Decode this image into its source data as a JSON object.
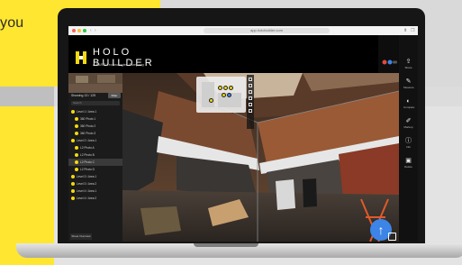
{
  "marketing": {
    "tagline_fragment": "you"
  },
  "browser": {
    "url": "app.holobuilder.com"
  },
  "app": {
    "logo_title_line1": "HOLO",
    "logo_title_line2": "BUILDER",
    "logo_subtitle": "A FARO Technologies Company"
  },
  "left_panel": {
    "title": "Showing 13 / 125",
    "button_label": "Filter",
    "search_placeholder": "Search",
    "items": [
      {
        "label": "Level 1 / Area 1",
        "selected": false
      },
      {
        "label": "360 Photo 1",
        "selected": false
      },
      {
        "label": "360 Photo 2",
        "selected": false
      },
      {
        "label": "360 Photo 3",
        "selected": false
      },
      {
        "label": "Level 2 / Area 1",
        "selected": false
      },
      {
        "label": "L2 Photo A",
        "selected": false
      },
      {
        "label": "L2 Photo B",
        "selected": false
      },
      {
        "label": "L2 Photo C",
        "selected": true
      },
      {
        "label": "L2 Photo D",
        "selected": false
      },
      {
        "label": "Level 3 / Area 1",
        "selected": false
      },
      {
        "label": "Level 3 / Area 2",
        "selected": false
      },
      {
        "label": "Level 4 / Area 1",
        "selected": false
      },
      {
        "label": "Level 4 / Area 2",
        "selected": false
      }
    ],
    "footer_label": "Sheet Overview"
  },
  "right_toolbar": [
    {
      "icon": "share-icon",
      "label": "Share"
    },
    {
      "icon": "measure-icon",
      "label": "Measure"
    },
    {
      "icon": "compare-icon",
      "label": "Compare"
    },
    {
      "icon": "markup-icon",
      "label": "Markup"
    },
    {
      "icon": "info-icon",
      "label": "Info"
    },
    {
      "icon": "trash-icon",
      "label": "Delete"
    }
  ],
  "colors": {
    "brand_yellow": "#ffe631",
    "nav_blue": "#3c84e6",
    "panel_dark": "#1b1b1b"
  }
}
